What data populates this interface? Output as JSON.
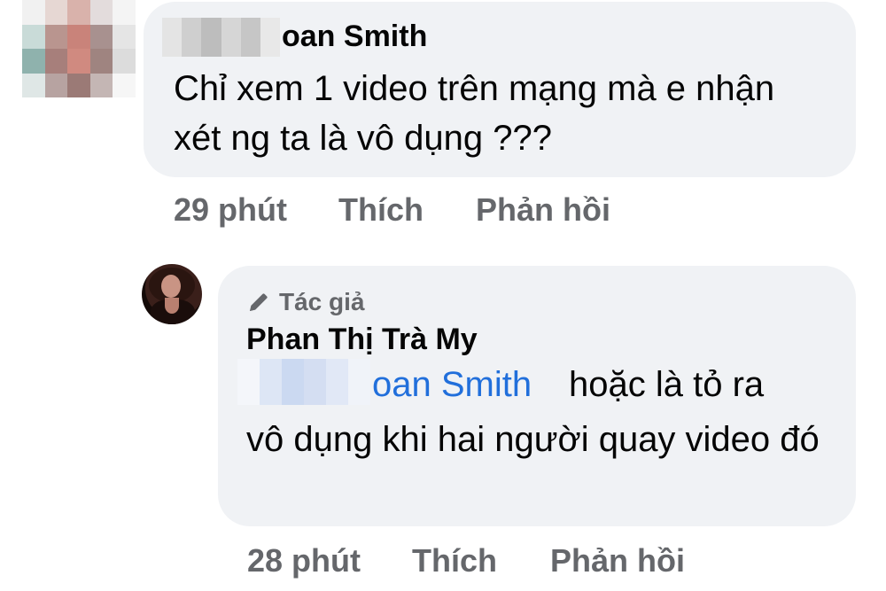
{
  "comments": [
    {
      "author_visible": "oan Smith",
      "text": "Chỉ xem 1 video trên mạng mà e nhận xét ng ta là vô dụng ???",
      "time": "29 phút",
      "like_label": "Thích",
      "reply_label": "Phản hồi"
    },
    {
      "badge_icon": "pencil-icon",
      "badge": "Tác giả",
      "author": "Phan Thị Trà My",
      "mention": "oan Smith",
      "text_line1": "hoặc là tỏ ra",
      "text_rest": "vô dụng khi hai người quay video đó",
      "time": "28 phút",
      "like_label": "Thích",
      "reply_label": "Phản hồi"
    }
  ],
  "colors": {
    "bubble": "#f0f2f5",
    "text": "#050505",
    "secondary": "#65676b",
    "mention": "#216fdb"
  }
}
